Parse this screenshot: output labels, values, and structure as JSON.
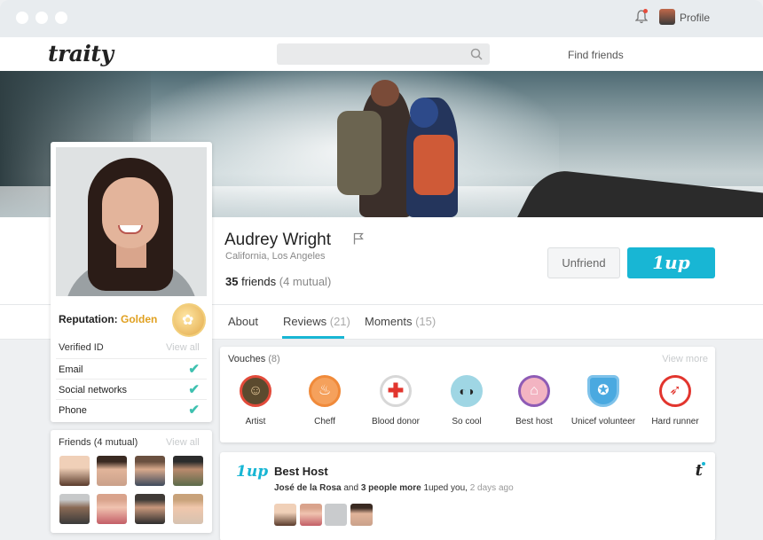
{
  "app": {
    "logo": "traity"
  },
  "nav": {
    "find_friends": "Find friends",
    "profile": "Profile"
  },
  "profile": {
    "name": "Audrey Wright",
    "location": "California, Los Angeles",
    "friends_count": "35",
    "friends_word": "friends",
    "mutual": "(4 mutual)"
  },
  "actions": {
    "unfriend": "Unfriend",
    "oneup": "1up"
  },
  "reputation": {
    "label": "Reputation:",
    "level": "Golden"
  },
  "verified": {
    "title": "Verified ID",
    "view_all": "View all",
    "items": [
      {
        "label": "Email"
      },
      {
        "label": "Social networks"
      },
      {
        "label": "Phone"
      }
    ]
  },
  "friends_box": {
    "title": "Friends (4 mutual)",
    "view_all": "View all"
  },
  "tabs": [
    {
      "label": "About",
      "count": ""
    },
    {
      "label": "Reviews",
      "count": "(21)"
    },
    {
      "label": "Moments",
      "count": "(15)"
    }
  ],
  "vouches": {
    "title": "Vouches",
    "count": "(8)",
    "view_more": "View more",
    "items": [
      {
        "label": "Artist",
        "icon": "mona-lisa-icon"
      },
      {
        "label": "Cheff",
        "icon": "chef-hat-icon"
      },
      {
        "label": "Blood donor",
        "icon": "red-cross-icon"
      },
      {
        "label": "So cool",
        "icon": "sunglasses-icon"
      },
      {
        "label": "Best host",
        "icon": "house-icon"
      },
      {
        "label": "Unicef volunteer",
        "icon": "unicef-icon"
      },
      {
        "label": "Hard runner",
        "icon": "running-shoe-icon"
      }
    ]
  },
  "review": {
    "logo": "1up",
    "title": "Best Host",
    "author": "José de la Rosa",
    "and": "and",
    "others": "3 people more",
    "action": "1uped you,",
    "ago": "2 days ago",
    "brand_mark": "t"
  }
}
